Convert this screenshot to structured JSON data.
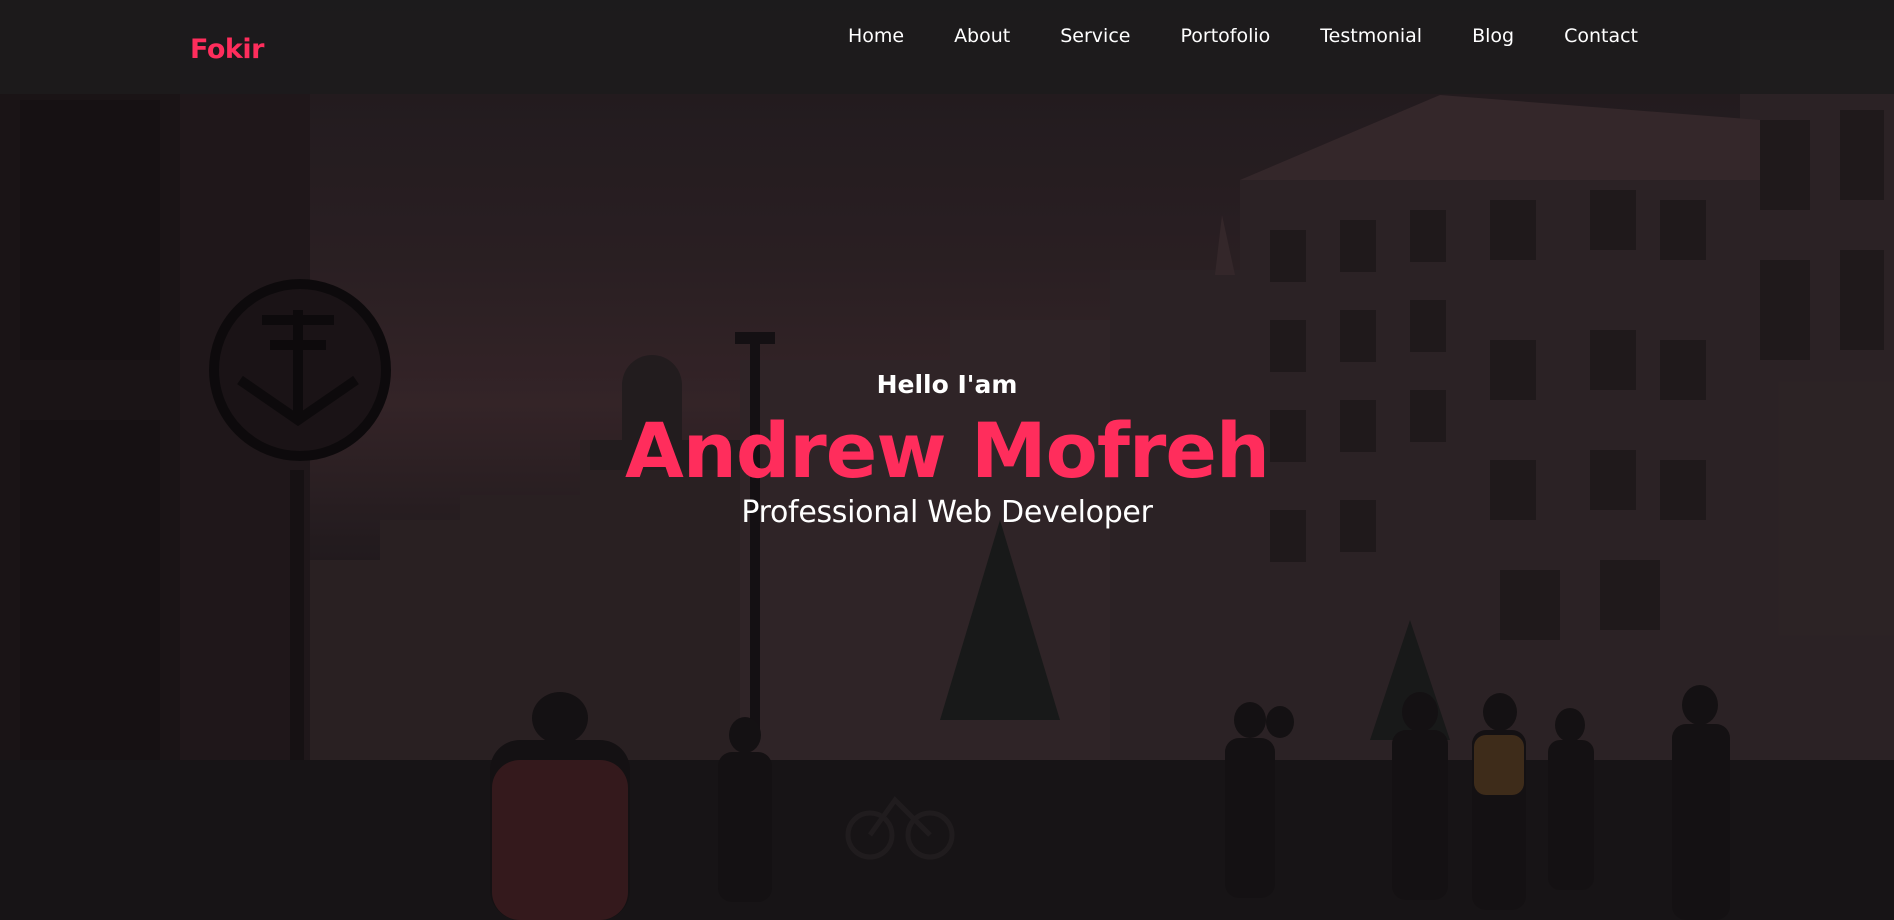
{
  "brand": {
    "logo_text": "Fokir",
    "accent_color": "#ff2d5c"
  },
  "nav": {
    "items": [
      {
        "label": "Home"
      },
      {
        "label": "About"
      },
      {
        "label": "Service"
      },
      {
        "label": "Portofolio"
      },
      {
        "label": "Testmonial"
      },
      {
        "label": "Blog"
      },
      {
        "label": "Contact"
      }
    ]
  },
  "hero": {
    "greeting": "Hello I'am",
    "name": "Andrew Mofreh",
    "role": "Professional Web Developer",
    "background_image": "dimmed photo of a European city street with pedestrians at dusk"
  }
}
